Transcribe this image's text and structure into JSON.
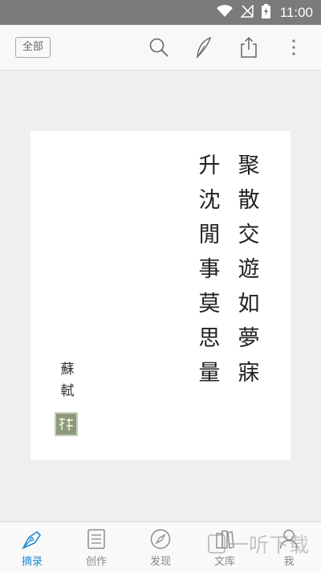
{
  "status_bar": {
    "time": "11:00"
  },
  "toolbar": {
    "filter_label": "全部",
    "icons": [
      "search-icon",
      "feather-pen-icon",
      "share-icon",
      "more-vert-icon"
    ]
  },
  "card": {
    "verse_lines": [
      "聚散交遊如夢寐",
      "升沈閒事莫思量"
    ],
    "author": "蘇軾",
    "seal": "seal-stamp"
  },
  "tabbar": {
    "tabs": [
      {
        "label": "摘录",
        "icon": "pen-nib-icon",
        "active": true
      },
      {
        "label": "创作",
        "icon": "notebook-icon",
        "active": false
      },
      {
        "label": "发现",
        "icon": "compass-icon",
        "active": false
      },
      {
        "label": "文库",
        "icon": "books-icon",
        "active": false
      },
      {
        "label": "我",
        "icon": "person-icon",
        "active": false
      }
    ]
  },
  "colors": {
    "active_tab": "#1d8bd8",
    "statusbar": "#7b7b7b"
  },
  "watermark": "一听下载"
}
